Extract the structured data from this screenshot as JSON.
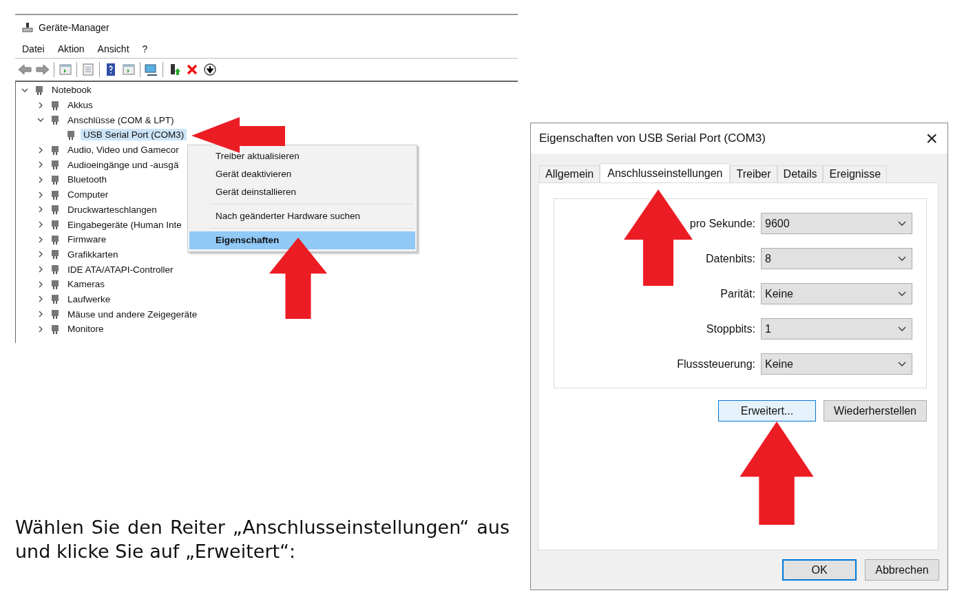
{
  "device_manager": {
    "window": {
      "title": "Geräte-Manager"
    },
    "menu": [
      "Datei",
      "Aktion",
      "Ansicht",
      "?"
    ],
    "tree": {
      "label": "Notebook",
      "expanded": true,
      "selected": false,
      "children": [
        {
          "label": "Akkus",
          "expanded": false,
          "selected": false
        },
        {
          "label": "Anschlüsse (COM & LPT)",
          "expanded": true,
          "selected": false,
          "children": [
            {
              "label": "USB Serial Port (COM3)",
              "selected": true
            }
          ]
        },
        {
          "label": "Audio, Video und Gamecor",
          "expanded": false,
          "selected": false
        },
        {
          "label": "Audioeingänge und -ausgä",
          "expanded": false,
          "selected": false
        },
        {
          "label": "Bluetooth",
          "expanded": false,
          "selected": false
        },
        {
          "label": "Computer",
          "expanded": false,
          "selected": false
        },
        {
          "label": "Druckwarteschlangen",
          "expanded": false,
          "selected": false
        },
        {
          "label": "Eingabegeräte (Human Inte",
          "expanded": false,
          "selected": false
        },
        {
          "label": "Firmware",
          "expanded": false,
          "selected": false
        },
        {
          "label": "Grafikkarten",
          "expanded": false,
          "selected": false
        },
        {
          "label": "IDE ATA/ATAPI-Controller",
          "expanded": false,
          "selected": false
        },
        {
          "label": "Kameras",
          "expanded": false,
          "selected": false
        },
        {
          "label": "Laufwerke",
          "expanded": false,
          "selected": false
        },
        {
          "label": "Mäuse und andere Zeigegeräte",
          "expanded": false,
          "selected": false
        },
        {
          "label": "Monitore",
          "expanded": false,
          "selected": false
        }
      ]
    },
    "context_menu": [
      {
        "label": "Treiber aktualisieren",
        "separator_before": false,
        "selected": false,
        "default": false
      },
      {
        "label": "Gerät deaktivieren",
        "separator_before": false,
        "selected": false,
        "default": false
      },
      {
        "label": "Gerät deinstallieren",
        "separator_before": false,
        "selected": false,
        "default": false
      },
      {
        "label": "Nach geänderter Hardware suchen",
        "separator_before": true,
        "selected": false,
        "default": false
      },
      {
        "label": "Eigenschaften",
        "separator_before": true,
        "selected": true,
        "default": true
      }
    ]
  },
  "caption": "Wählen Sie den Reiter „Anschlusseinstellungen“ aus und klicke Sie auf „Erweitert“:",
  "dialog": {
    "title": "Eigenschaften von USB Serial Port (COM3)",
    "close": "×",
    "tabs": [
      {
        "label": "Allgemein",
        "selected": false
      },
      {
        "label": "Anschlusseinstellungen",
        "selected": true
      },
      {
        "label": "Treiber",
        "selected": false
      },
      {
        "label": "Details",
        "selected": false
      },
      {
        "label": "Ereignisse",
        "selected": false
      }
    ],
    "settings": [
      {
        "label": "pro Sekunde:",
        "value": "9600"
      },
      {
        "label": "Datenbits:",
        "value": "8"
      },
      {
        "label": "Parität:",
        "value": "Keine"
      },
      {
        "label": "Stoppbits:",
        "value": "1"
      },
      {
        "label": "Flusssteuerung:",
        "value": "Keine"
      }
    ],
    "panel_buttons": [
      {
        "label": "Erweitert...",
        "focused": true
      },
      {
        "label": "Wiederherstellen",
        "focused": false
      }
    ],
    "buttons": [
      {
        "label": "OK",
        "default": true
      },
      {
        "label": "Abbrechen",
        "default": false
      }
    ]
  }
}
